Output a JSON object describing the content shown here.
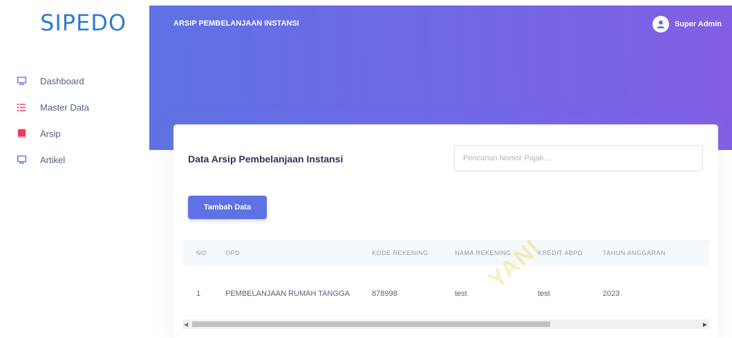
{
  "sidebar": {
    "brand": "SIPEDO",
    "items": [
      {
        "label": "Dashboard",
        "icon": "monitor-icon"
      },
      {
        "label": "Master Data",
        "icon": "list-icon"
      },
      {
        "label": "Arsip",
        "icon": "book-icon"
      },
      {
        "label": "Artikel",
        "icon": "monitor-icon"
      }
    ]
  },
  "header": {
    "title": "ARSIP PEMBELANJAAN INSTANSI",
    "user_name": "Super Admin",
    "gradient_start": "#5e72e4",
    "gradient_end": "#825ee4"
  },
  "main": {
    "card_title": "Data Arsip Pembelanjaan Instansi",
    "search_placeholder": "Pencarian Nomor Pajak ...",
    "search_value": "",
    "add_button": "Tambah Data",
    "table": {
      "columns": [
        "NO",
        "OPD",
        "KODE REKENING",
        "NAMA REKENING",
        "KREDIT ABPD",
        "TAHUN ANGGARAN"
      ],
      "rows": [
        [
          "1",
          "PEMBELANJAAN RUMAH TANGGA",
          "878998",
          "test",
          "test",
          "2023"
        ]
      ]
    }
  },
  "watermark": "YANI",
  "colors": {
    "brand": "#2e7bd6",
    "primary": "#5e72e4",
    "icon_monitor": "#5e72e4",
    "icon_list": "#f5365c",
    "icon_book": "#f5365c"
  }
}
